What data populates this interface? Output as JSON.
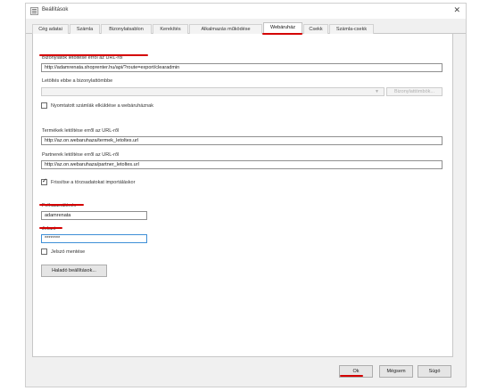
{
  "window": {
    "title": "Beállítások"
  },
  "tabs": [
    {
      "label": "Cég adatai"
    },
    {
      "label": "Számla"
    },
    {
      "label": "Bizonylatsablon"
    },
    {
      "label": "Kerekítés"
    },
    {
      "label": "Alkalmazás működése"
    },
    {
      "label": "Webáruház",
      "active": true
    },
    {
      "label": "Csekk"
    },
    {
      "label": "Számla-csekk"
    }
  ],
  "form": {
    "download_url_label": "Bizonylatok letöltése erről az URL-ről",
    "download_url_value": "http://adamrenata.shoprenter.hu/api/?route=export/clearadmin",
    "download_folder_label": "Letöltés ebbe a bizonylattömbbe",
    "download_folder_button": "Bizonylattömbök...",
    "send_printed_label": "Nyomtatott számlák elküldése a webáruháznak",
    "send_printed_checked": false,
    "products_url_label": "Termékek letöltése erről az URL-ről",
    "products_url_value": "http://az.on.webaruhaza/termek_letoltes.url",
    "partners_url_label": "Partnerek letöltése erről az URL-ről",
    "partners_url_value": "http://az.on.webaruhaza/partner_letoltes.url",
    "update_master_label": "Frissítse a törzsadatokat importáláskor",
    "update_master_checked": true,
    "username_label": "Felhasználónév",
    "username_value": "adamrenata",
    "password_label": "Jelszó",
    "password_value": "********",
    "save_password_label": "Jelszó mentése",
    "save_password_checked": false,
    "advanced_button": "Haladó beállítások..."
  },
  "footer": {
    "ok": "Ok",
    "cancel": "Mégsem",
    "help": "Súgó"
  },
  "colors": {
    "annotation_red": "#d40000",
    "focus_blue": "#3e8fd7"
  }
}
